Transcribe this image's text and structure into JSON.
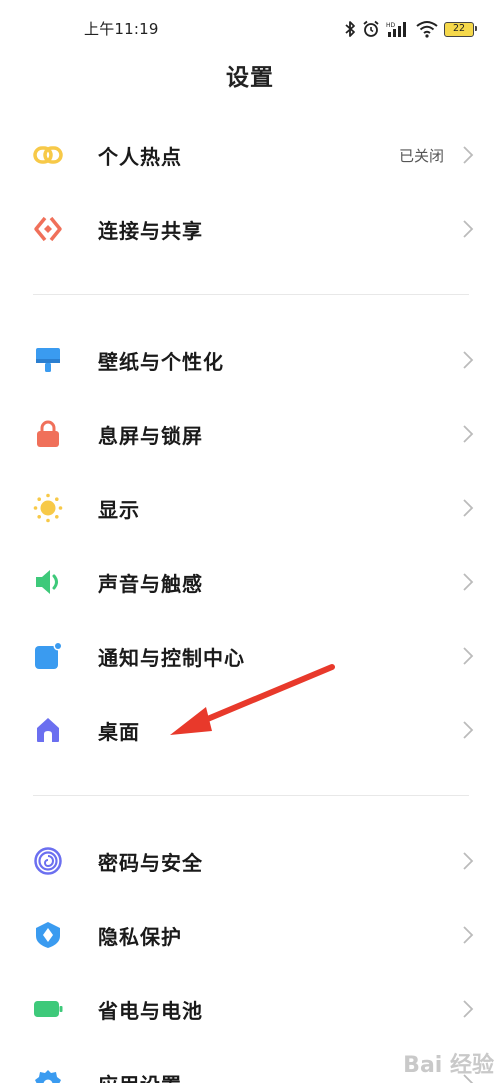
{
  "status_bar": {
    "time": "上午11:19",
    "battery": "22",
    "icons": [
      "bluetooth-icon",
      "alarm-icon",
      "hd-signal-icon",
      "wifi-icon",
      "battery-icon"
    ]
  },
  "header": {
    "title": "设置"
  },
  "groups": [
    {
      "items": [
        {
          "label": "个人热点",
          "value": "已关闭",
          "icon": "hotspot-icon",
          "color": "#f7c948"
        },
        {
          "label": "连接与共享",
          "value": "",
          "icon": "connection-share-icon",
          "color": "#f0705a"
        }
      ]
    },
    {
      "items": [
        {
          "label": "壁纸与个性化",
          "value": "",
          "icon": "wallpaper-brush-icon",
          "color": "#3a9bf0"
        },
        {
          "label": "息屏与锁屏",
          "value": "",
          "icon": "lock-icon",
          "color": "#f0705a"
        },
        {
          "label": "显示",
          "value": "",
          "icon": "sun-icon",
          "color": "#f7c948"
        },
        {
          "label": "声音与触感",
          "value": "",
          "icon": "speaker-icon",
          "color": "#3ec97a"
        },
        {
          "label": "通知与控制中心",
          "value": "",
          "icon": "notification-icon",
          "color": "#3a9bf0"
        },
        {
          "label": "桌面",
          "value": "",
          "icon": "home-icon",
          "color": "#6b6ff0"
        }
      ]
    },
    {
      "items": [
        {
          "label": "密码与安全",
          "value": "",
          "icon": "fingerprint-icon",
          "color": "#6b6ff0"
        },
        {
          "label": "隐私保护",
          "value": "",
          "icon": "privacy-shield-icon",
          "color": "#3a9bf0"
        },
        {
          "label": "省电与电池",
          "value": "",
          "icon": "battery-saver-icon",
          "color": "#3ec97a"
        },
        {
          "label": "应用设置",
          "value": "",
          "icon": "app-settings-gear-icon",
          "color": "#3a9bf0"
        }
      ]
    }
  ],
  "annotation": {
    "arrow_color": "#e8392b"
  },
  "watermark": {
    "text": "Bai 经验"
  }
}
